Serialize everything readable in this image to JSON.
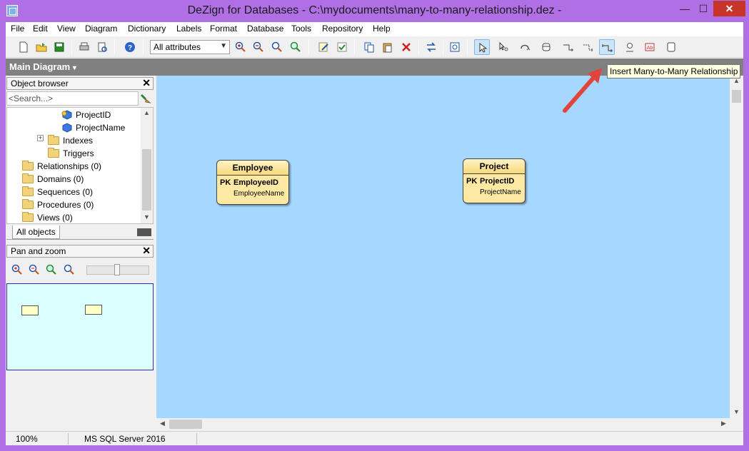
{
  "window": {
    "title": "DeZign for Databases - C:\\mydocuments\\many-to-many-relationship.dez -",
    "minimize_label": "—",
    "maximize_label": "☐",
    "close_label": "✕"
  },
  "menu": [
    "File",
    "Edit",
    "View",
    "Diagram",
    "Dictionary",
    "Labels",
    "Format",
    "Database",
    "Tools",
    "Repository",
    "Help"
  ],
  "toolbar": {
    "attribute_filter": "All attributes",
    "active_tool": "insert-many-to-many-relationship",
    "tooltip": "Insert Many-to-Many Relationship"
  },
  "diagram": {
    "name": "Main Diagram",
    "dropdown_glyph": "▾"
  },
  "object_browser": {
    "title": "Object browser",
    "search_placeholder": "<Search...>",
    "tree": [
      {
        "label": "ProjectID",
        "type": "pk-attribute"
      },
      {
        "label": "ProjectName",
        "type": "attribute"
      },
      {
        "label": "Indexes",
        "type": "folder"
      },
      {
        "label": "Triggers",
        "type": "folder"
      },
      {
        "label": "Relationships (0)",
        "type": "folder"
      },
      {
        "label": "Domains (0)",
        "type": "folder"
      },
      {
        "label": "Sequences (0)",
        "type": "folder"
      },
      {
        "label": "Procedures (0)",
        "type": "folder"
      },
      {
        "label": "Views (0)",
        "type": "folder"
      }
    ],
    "tab": "All objects"
  },
  "pan_zoom": {
    "title": "Pan and zoom",
    "slider_level": 0.45
  },
  "entities": [
    {
      "name": "Employee",
      "pk_label": "PK",
      "pk_attr": "EmployeeID",
      "attr": "EmployeeName"
    },
    {
      "name": "Project",
      "pk_label": "PK",
      "pk_attr": "ProjectID",
      "attr": "ProjectName"
    }
  ],
  "status": {
    "zoom": "100%",
    "database": "MS SQL Server 2016"
  },
  "colors": {
    "window_frame": "#b16fe5",
    "canvas": "#a6d8ff",
    "entity_fill": "#fde9a4",
    "annotation_arrow": "#e0443a"
  }
}
